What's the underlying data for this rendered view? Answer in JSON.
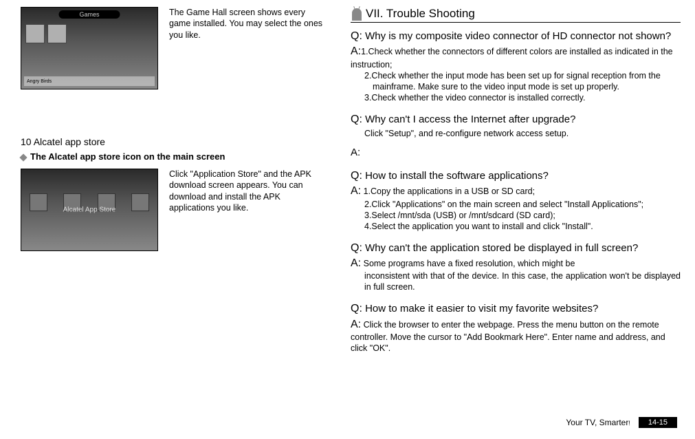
{
  "left": {
    "gamehall_desc": "The Game Hall screen shows every game installed. You may select the ones you like.",
    "games_topbar": "Games",
    "bottom_label": "Angry Birds",
    "section10_title": "10 Alcatel app store",
    "sub_heading": "The Alcatel app store icon on the main screen",
    "appstore_desc": "Click \"Application Store\" and the APK download screen appears. You can download and install the APK applications you like.",
    "appstore_label": "Alcatel App Store"
  },
  "right": {
    "chapter_title": "VII. Trouble Shooting",
    "q1": "Why is my composite video connector of HD connector not shown?",
    "a1_1": "1.Check whether the connectors of different colors are  installed as indicated in the instruction;",
    "a1_2": "2.Check whether the input mode has been set up for signal reception from the mainframe. Make sure to the video input mode is set up properly.",
    "a1_3": "3.Check whether the video connector is installed correctly.",
    "q2": "Why can't I access the Internet after upgrade?",
    "a2_sub": "Click \"Setup\", and re-configure network access setup.",
    "a2_label": "A:",
    "q3": "How to install the software applications?",
    "a3_1": "1.Copy the applications in a USB or SD card;",
    "a3_2": "2.Click \"Applications\" on the main screen and select \"Install Applications\";",
    "a3_3": "3.Select /mnt/sda (USB) or /mnt/sdcard (SD card);",
    "a3_4": "4.Select the application you want to install and click \"Install\".",
    "q4": "Why can't the application stored be displayed in full screen?",
    "a4_1": "Some programs have a fixed resolution, which might be",
    "a4_2": "inconsistent with that of the device. In this case, the application won't be displayed in full screen.",
    "q5": "How to make it easier to visit my favorite websites?",
    "a5": "Click the browser to enter the webpage. Press the menu button on the remote controller. Move the cursor to \"Add Bookmark Here\". Enter name and address, and click \"OK\"."
  },
  "footer": {
    "tagline": "Your TV, Smarter",
    "excl": "!",
    "page": "14-15"
  },
  "labels": {
    "Q": "Q:",
    "A": "A:"
  }
}
